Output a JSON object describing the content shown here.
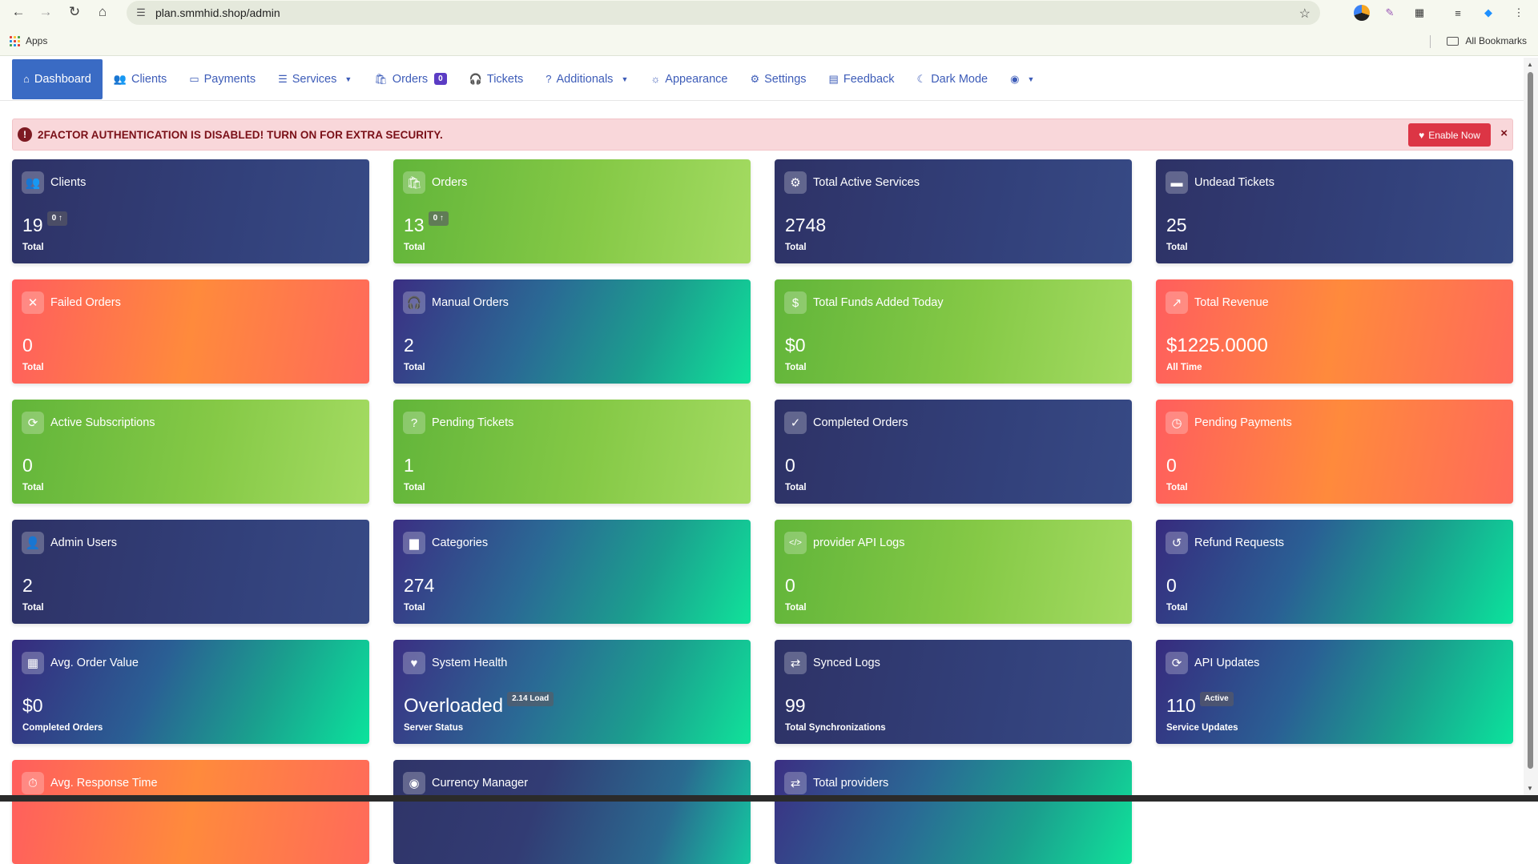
{
  "browser": {
    "url": "plan.smmhid.shop/admin",
    "bookmarks_apps": "Apps",
    "bookmarks_all": "All Bookmarks"
  },
  "nav": {
    "items": [
      {
        "label": "Dashboard",
        "icon": "home-icon"
      },
      {
        "label": "Clients",
        "icon": "users-icon"
      },
      {
        "label": "Payments",
        "icon": "money-icon"
      },
      {
        "label": "Services",
        "icon": "list-icon"
      },
      {
        "label": "Orders",
        "icon": "bag-icon",
        "badge": "0"
      },
      {
        "label": "Tickets",
        "icon": "headset-icon"
      },
      {
        "label": "Additionals",
        "icon": "question-icon"
      },
      {
        "label": "Appearance",
        "icon": "sun-icon"
      },
      {
        "label": "Settings",
        "icon": "gear-icon"
      },
      {
        "label": "Feedback",
        "icon": "comment-icon"
      },
      {
        "label": "Dark Mode",
        "icon": "moon-icon"
      }
    ]
  },
  "alert": {
    "text": "2FACTOR AUTHENTICATION IS DISABLED! TURN ON FOR EXTRA SECURITY.",
    "button": "Enable Now",
    "close": "×"
  },
  "cards": [
    {
      "title": "Clients",
      "value": "19",
      "chip": "0 ↑",
      "sub": "Total",
      "style": "navy",
      "icon": "users-icon"
    },
    {
      "title": "Orders",
      "value": "13",
      "chip": "0 ↑",
      "sub": "Total",
      "style": "green",
      "icon": "bag-icon"
    },
    {
      "title": "Total Active Services",
      "value": "2748",
      "sub": "Total",
      "style": "navy",
      "icon": "gears-icon"
    },
    {
      "title": "Undead Tickets",
      "value": "25",
      "sub": "Total",
      "style": "navy",
      "icon": "ticket-icon"
    },
    {
      "title": "Failed Orders",
      "value": "0",
      "sub": "Total",
      "style": "orange",
      "icon": "x-icon"
    },
    {
      "title": "Manual Orders",
      "value": "2",
      "sub": "Total",
      "style": "teal",
      "icon": "headset-icon"
    },
    {
      "title": "Total Funds Added Today",
      "value": "$0",
      "sub": "Total",
      "style": "green",
      "icon": "dollar-icon"
    },
    {
      "title": "Total Revenue",
      "value": "$1225.0000",
      "sub": "All Time",
      "style": "orange",
      "icon": "chart-line-icon"
    },
    {
      "title": "Active Subscriptions",
      "value": "0",
      "sub": "Total",
      "style": "green",
      "icon": "sync-icon"
    },
    {
      "title": "Pending Tickets",
      "value": "1",
      "sub": "Total",
      "style": "green",
      "icon": "question-icon"
    },
    {
      "title": "Completed Orders",
      "value": "0",
      "sub": "Total",
      "style": "navy",
      "icon": "check-icon"
    },
    {
      "title": "Pending Payments",
      "value": "0",
      "sub": "Total",
      "style": "orange",
      "icon": "clock-icon"
    },
    {
      "title": "Admin Users",
      "value": "2",
      "sub": "Total",
      "style": "navy",
      "icon": "user-gear-icon"
    },
    {
      "title": "Categories",
      "value": "274",
      "sub": "Total",
      "style": "teal",
      "icon": "folder-icon"
    },
    {
      "title": "provider API Logs",
      "value": "0",
      "sub": "Total",
      "style": "green",
      "icon": "code-icon"
    },
    {
      "title": "Refund Requests",
      "value": "0",
      "sub": "Total",
      "style": "teal2",
      "icon": "undo-icon"
    },
    {
      "title": "Avg. Order Value",
      "value": "$0",
      "sub": "Completed Orders",
      "style": "teal2",
      "icon": "calculator-icon"
    },
    {
      "title": "System Health",
      "value": "Overloaded",
      "chip": "2.14 Load",
      "sub": "Server Status",
      "style": "teal",
      "icon": "heart-pulse-icon"
    },
    {
      "title": "Synced Logs",
      "value": "99",
      "sub": "Total Synchronizations",
      "style": "navy",
      "icon": "exchange-icon"
    },
    {
      "title": "API Updates",
      "value": "110",
      "chip": "Active",
      "sub": "Service Updates",
      "style": "teal2",
      "icon": "sync-icon"
    },
    {
      "title": "Avg. Response Time",
      "value": "",
      "sub": "",
      "style": "orange",
      "icon": "stopwatch-icon"
    },
    {
      "title": "Currency Manager",
      "value": "",
      "sub": "",
      "style": "navyteal",
      "icon": "coins-icon"
    },
    {
      "title": "Total providers",
      "value": "",
      "sub": "",
      "style": "teal",
      "icon": "exchange-icon"
    }
  ]
}
